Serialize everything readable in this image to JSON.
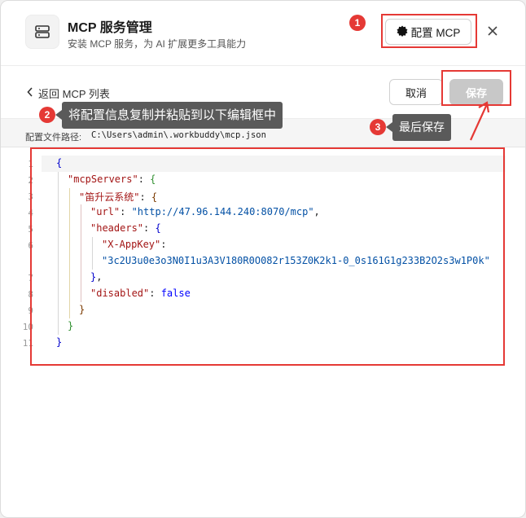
{
  "header": {
    "title": "MCP 服务管理",
    "subtitle": "安装 MCP 服务，为 AI 扩展更多工具能力",
    "config_button_label": "配置 MCP"
  },
  "toolbar": {
    "back_label": "返回 MCP 列表",
    "cancel_label": "取消",
    "save_label": "保存"
  },
  "config_path": {
    "label": "配置文件路径:",
    "value": "C:\\Users\\admin\\.workbuddy\\mcp.json"
  },
  "editor": {
    "line_numbers": [
      "1",
      "2",
      "3",
      "4",
      "5",
      "6",
      "7",
      "8",
      "9",
      "10",
      "11"
    ],
    "key_mcpServers": "\"mcpServers\"",
    "key_server": "\"笛升云系统\"",
    "key_url": "\"url\"",
    "val_url": "\"http://47.96.144.240:8070/mcp\"",
    "key_headers": "\"headers\"",
    "key_appkey": "\"X-AppKey\"",
    "val_appkey": "\"3c2U3u0e3o3N0I1u3A3V180R0O082r153Z0K2k1-0_0s161G1g233B2O2s3w1P0k\"",
    "key_disabled": "\"disabled\"",
    "val_disabled": "false"
  },
  "annotations": {
    "badge1": "1",
    "badge2": "2",
    "badge3": "3",
    "callout2": "将配置信息复制并粘贴到以下编辑框中",
    "callout3": "最后保存"
  },
  "colors": {
    "annotation_red": "#e53935",
    "callout_bg": "#5a5a5a",
    "save_disabled": "#c8c8c8"
  }
}
